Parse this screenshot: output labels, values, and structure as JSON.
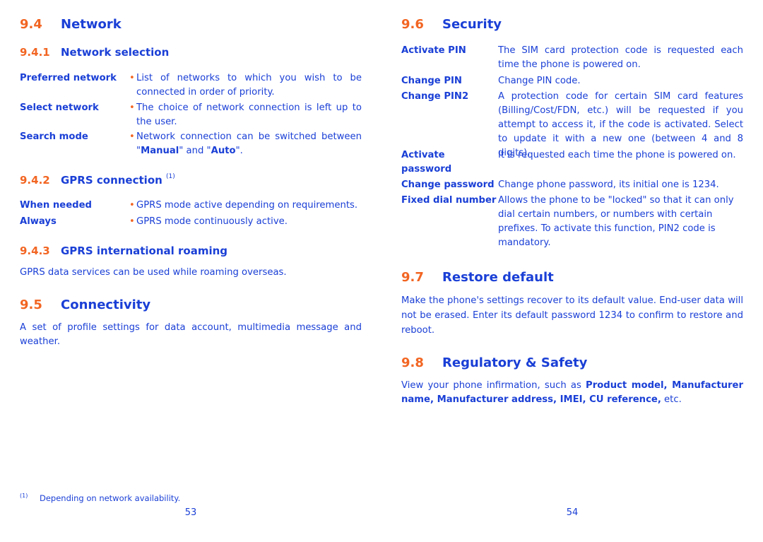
{
  "colors": {
    "text": "#1a3fd6",
    "accent": "#f26522",
    "background": "#ffffff"
  },
  "left_page": {
    "s94": {
      "num": "9.4",
      "title": "Network"
    },
    "s941": {
      "num": "9.4.1",
      "title": "Network selection",
      "items": [
        {
          "term": "Preferred network",
          "desc": "List of networks to which you wish to be connected in order of priority."
        },
        {
          "term": "Select network",
          "desc": "The choice of network connection is left up to the user."
        },
        {
          "term": "Search mode",
          "desc_pre": "Network connection can be switched between \"",
          "desc_b1": "Manual",
          "desc_mid": "\" and \"",
          "desc_b2": "Auto",
          "desc_post": "\"."
        }
      ]
    },
    "s942": {
      "num": "9.4.2",
      "title": "GPRS connection",
      "footnote_ref": "(1)",
      "items": [
        {
          "term": "When needed",
          "desc": "GPRS mode active depending on requirements."
        },
        {
          "term": "Always",
          "desc": "GPRS mode continuously active."
        }
      ]
    },
    "s943": {
      "num": "9.4.3",
      "title": "GPRS international roaming",
      "body": "GPRS data services can be used while roaming overseas."
    },
    "s95": {
      "num": "9.5",
      "title": "Connectivity",
      "body": "A set of profile settings for data account, multimedia message and weather."
    },
    "footnote": {
      "mark": "(1)",
      "text": "Depending on network availability."
    },
    "page_number": "53"
  },
  "right_page": {
    "s96": {
      "num": "9.6",
      "title": "Security",
      "items": [
        {
          "term": "Activate PIN",
          "desc": "The SIM card protection code is requested each time the phone is powered on."
        },
        {
          "term": "Change PIN",
          "desc": "Change PIN code."
        },
        {
          "term": "Change PIN2",
          "desc": "A protection code for certain SIM card features (Billing/Cost/FDN, etc.) will be requested if you attempt to access it, if the code is activated. Select to update it with a new one (between 4 and 8 digits)."
        },
        {
          "term": "Activate password",
          "desc": "It is requested each time the phone is powered on."
        },
        {
          "term": "Change password",
          "desc": "Change phone password, its initial one is 1234."
        },
        {
          "term": "Fixed dial number",
          "desc": "Allows the phone to be \"locked\" so that it can only dial certain numbers, or numbers with certain prefixes. To activate this function, PIN2 code is mandatory."
        }
      ]
    },
    "s97": {
      "num": "9.7",
      "title": "Restore default",
      "body": "Make the phone's settings recover to its default value. End-user data will not be erased. Enter its default password 1234 to confirm to restore and reboot."
    },
    "s98": {
      "num": "9.8",
      "title": "Regulatory & Safety",
      "body_pre": "View your phone infirmation, such as ",
      "body_bold": "Product  model, Manufacturer name, Manufacturer address, IMEI, CU reference,",
      "body_post": " etc."
    },
    "page_number": "54"
  }
}
